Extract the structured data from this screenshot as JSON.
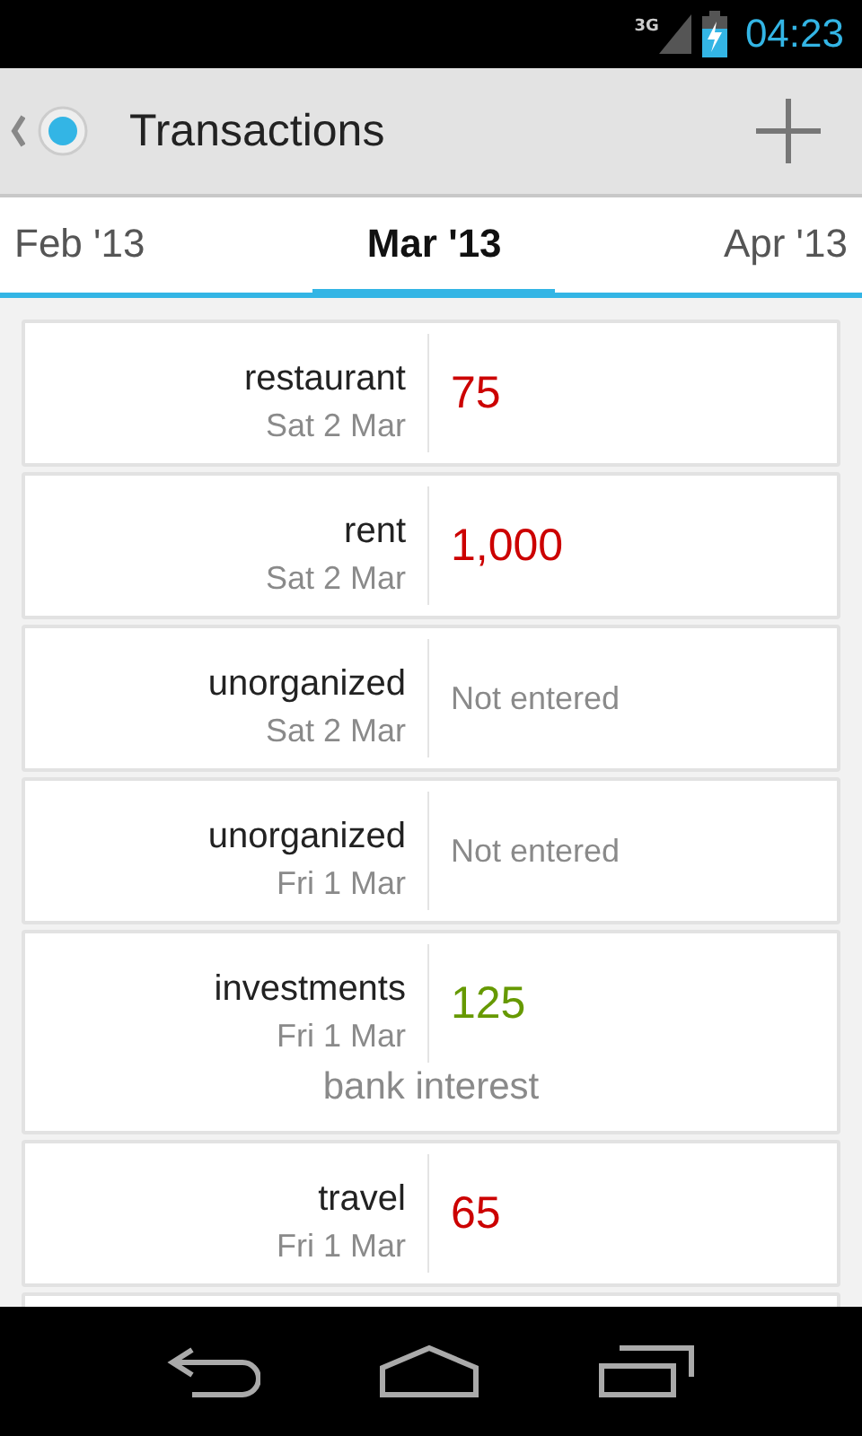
{
  "status_bar": {
    "network": "3G",
    "time": "04:23"
  },
  "action_bar": {
    "title": "Transactions"
  },
  "tabs": [
    {
      "label": "Feb '13",
      "selected": false
    },
    {
      "label": "Mar '13",
      "selected": true
    },
    {
      "label": "Apr '13",
      "selected": false
    }
  ],
  "transactions": [
    {
      "category": "restaurant",
      "date": "Sat 2 Mar",
      "kind": "expense",
      "amount": "75"
    },
    {
      "category": "rent",
      "date": "Sat 2 Mar",
      "kind": "expense",
      "amount": "1,000"
    },
    {
      "category": "unorganized",
      "date": "Sat 2 Mar",
      "kind": "missing",
      "amount": "Not entered"
    },
    {
      "category": "unorganized",
      "date": "Fri 1 Mar",
      "kind": "missing",
      "amount": "Not entered"
    },
    {
      "category": "investments",
      "date": "Fri 1 Mar",
      "kind": "income",
      "amount": "125",
      "note": "bank interest"
    },
    {
      "category": "travel",
      "date": "Fri 1 Mar",
      "kind": "expense",
      "amount": "65"
    }
  ]
}
